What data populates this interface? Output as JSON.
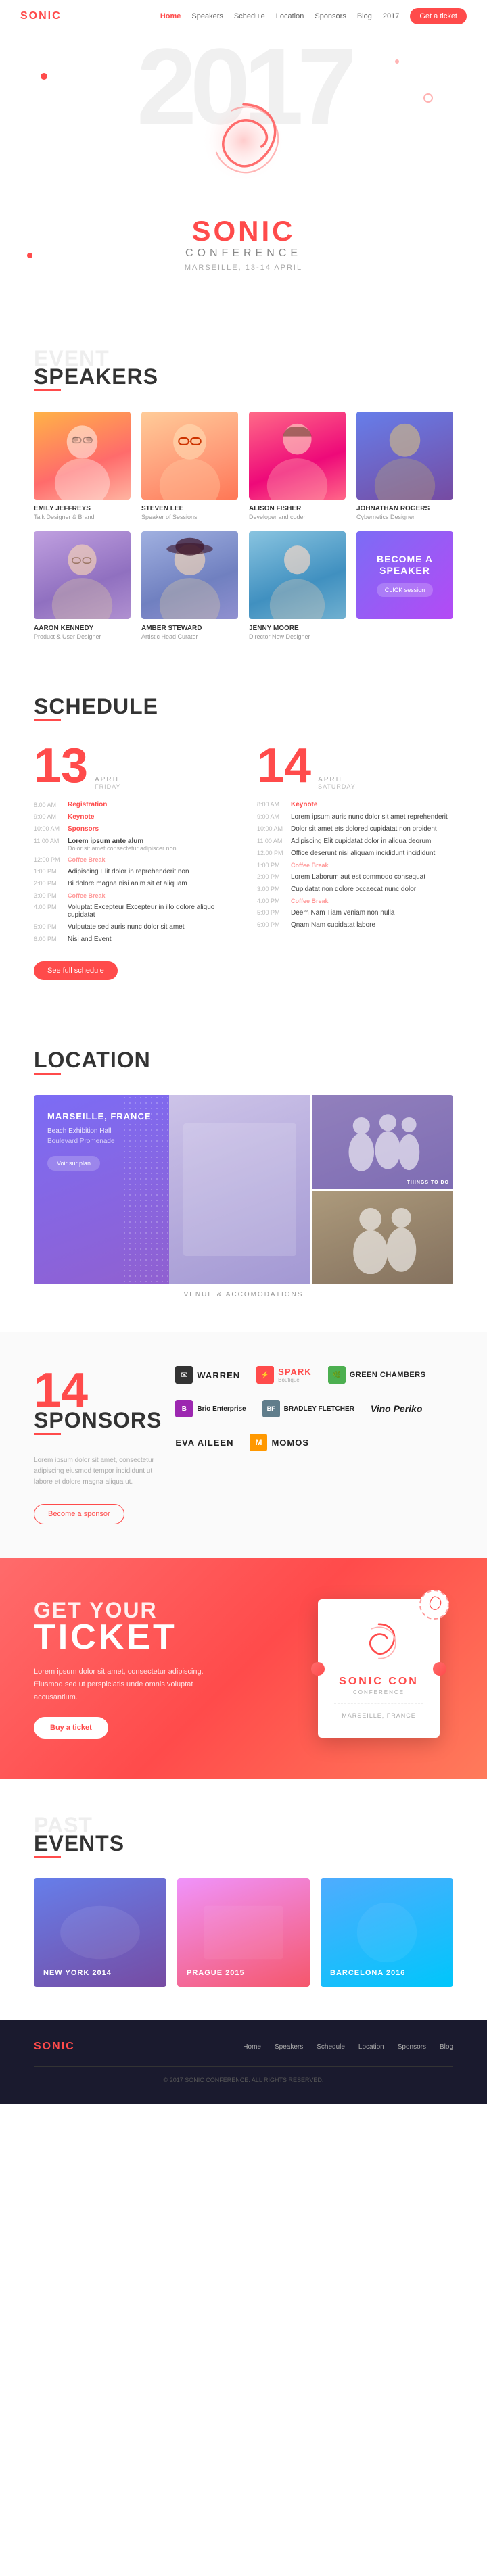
{
  "nav": {
    "logo": "SONIC",
    "links": [
      "Home",
      "Speakers",
      "Schedule",
      "Location",
      "Sponsors",
      "Blog",
      "2017"
    ],
    "cta": "Get a ticket"
  },
  "hero": {
    "year": "2017",
    "title": "SONIC",
    "subtitle": "CONFERENCE",
    "date": "MARSEILLE, 13-14 APRIL"
  },
  "speakers": {
    "section_title": "EVENT",
    "section_subtitle": "SPEAKERS",
    "people": [
      {
        "name": "EMILY JEFFREYS",
        "role": "Talk Designer & Brand"
      },
      {
        "name": "STEVEN LEE",
        "role": "Speaker of Sessions"
      },
      {
        "name": "ALISON FISHER",
        "role": "Developer and coder"
      },
      {
        "name": "JOHNATHAN ROGERS",
        "role": "Cybernetics Designer"
      },
      {
        "name": "AARON KENNEDY",
        "role": "Product & User Designer"
      },
      {
        "name": "AMBER STEWARD",
        "role": "Artistic Head Curator"
      },
      {
        "name": "JENNY MOORE",
        "role": "Director New Designer"
      }
    ],
    "become_speaker": {
      "title": "BECOME A SPEAKER",
      "button": "CLICK session"
    }
  },
  "schedule": {
    "section_title": "SCHEDULE",
    "day1": {
      "date": "13",
      "month": "APRIL",
      "day_label": "FRIDAY",
      "events": [
        {
          "time": "8:00 AM",
          "title": "Registration",
          "type": "header"
        },
        {
          "time": "9:00 AM",
          "title": "Keynote"
        },
        {
          "time": "10:00 AM",
          "title": "Sponsors"
        },
        {
          "time": "11:00 AM",
          "title": "Lorem ipsum ante alum",
          "desc": "Dolor sit amet consectetur adipiscer non"
        },
        {
          "time": "12:00 PM",
          "title": "Coffee Break",
          "type": "break"
        },
        {
          "time": "1:00 PM",
          "title": "Adipiscing Elit dolor in reprehenderit non"
        },
        {
          "time": "2:00 PM",
          "title": "Bi dolore magna nisi anim sit et aliquam"
        },
        {
          "time": "3:00 PM",
          "title": "Coffee Break",
          "type": "break"
        },
        {
          "time": "4:00 PM",
          "title": "Voluptat Excepteur Excepteur in illo dolore aliquo cupidatat"
        },
        {
          "time": "5:00 PM",
          "title": "Vulputate sed auris nunc dolor sit amet"
        },
        {
          "time": "6:00 PM",
          "title": "Nisi and Event"
        }
      ]
    },
    "day2": {
      "date": "14",
      "month": "APRIL",
      "day_label": "SATURDAY",
      "events": [
        {
          "time": "8:00 AM",
          "title": "Keynote",
          "type": "header"
        },
        {
          "time": "9:00 AM",
          "title": "Lorem ipsum auris nunc dolor sit amet reprehenderit"
        },
        {
          "time": "10:00 AM",
          "title": "Dolor sit amet ets dolored cupidatat non proident"
        },
        {
          "time": "11:00 AM",
          "title": "Adipiscing Elit cupidatat dolor in aliqua deorum"
        },
        {
          "time": "12:00 PM",
          "title": "Office deserunt nisi aliquam incididunt incididunt"
        },
        {
          "time": "1:00 PM",
          "title": "Coffee Break",
          "type": "break"
        },
        {
          "time": "2:00 PM",
          "title": "Lorem Laborum aut est commodo consequat"
        },
        {
          "time": "3:00 PM",
          "title": "Cupidatat non dolore occaecat nunc dolor"
        },
        {
          "time": "4:00 PM",
          "title": "Coffee Break",
          "type": "break"
        },
        {
          "time": "5:00 PM",
          "title": "Deem Nam Tiam veniam non nulla"
        },
        {
          "time": "6:00 PM",
          "title": "Qnam Nam cupidatat labore"
        }
      ]
    },
    "see_all_btn": "See full schedule"
  },
  "location": {
    "section_title": "LOCATION",
    "map": {
      "city": "MARSEILLE, FRANCE",
      "venue": "Beach Exhibition Hall",
      "address": "Boulevard Promenade",
      "btn": "Voir sur plan"
    },
    "labels": {
      "main": "VENUE & ACCOMODATIONS",
      "things": "THINGS TO DO"
    }
  },
  "sponsors": {
    "count": "14",
    "section_title": "SPONSORS",
    "desc": "Lorem ipsum dolor sit amet, consectetur adipiscing eiusmod tempor incididunt ut labore et dolore magna aliqua ut.",
    "logos": [
      {
        "name": "WARREN",
        "icon": "✉"
      },
      {
        "name": "SPARK",
        "tagline": "Boutique"
      },
      {
        "name": "GREEN CHAMBERS",
        "icon": "🌿"
      },
      {
        "name": "Brio Enterprise",
        "icon": "B"
      },
      {
        "name": "BRADLEY FLETCHER",
        "icon": "BF"
      },
      {
        "name": "Vino Periko",
        "icon": "🍷"
      },
      {
        "name": "EVA AILEEN"
      },
      {
        "name": "MOMOS",
        "icon": "M"
      }
    ],
    "become_btn": "Become a sponsor"
  },
  "ticket": {
    "pretitle": "GET YOUR",
    "title": "TICKET",
    "desc": "Lorem ipsum dolor sit amet, consectetur adipiscing. Eiusmod sed ut perspiciatis unde omnis voluptat accusantium.",
    "buy_btn": "Buy a ticket",
    "card": {
      "title": "SONIC CON",
      "subtitle": "CONFERENCE",
      "location": "MARSEILLE, FRANCE"
    }
  },
  "past_events": {
    "section_title": "PAST",
    "section_subtitle": "EVENTS",
    "events": [
      {
        "title": "NEW YORK 2014",
        "city": "NEW YORK"
      },
      {
        "title": "PRAGUE 2015",
        "city": "PRAGUE"
      },
      {
        "title": "BARCELONA 2016",
        "city": "BARCELONA"
      }
    ]
  },
  "footer": {
    "logo": "SONIC",
    "links": [
      "Home",
      "Speakers",
      "Schedule",
      "Location",
      "Sponsors",
      "Blog"
    ],
    "copy": "© 2017 SONIC CONFERENCE. ALL RIGHTS RESERVED."
  }
}
